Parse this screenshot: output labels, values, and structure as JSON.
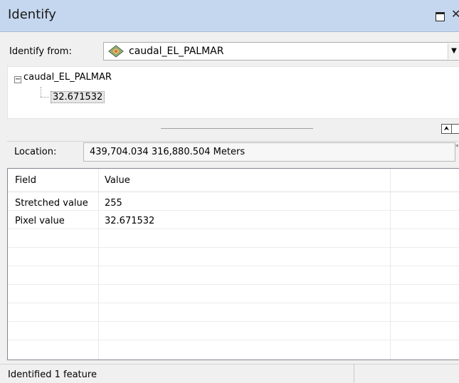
{
  "window": {
    "title": "Identify"
  },
  "titlebar_icons": [
    "restore-icon",
    "close-icon"
  ],
  "identify_from": {
    "label": "Identify from:",
    "selected": "caudal_EL_PALMAR",
    "icon": "raster-layer-icon"
  },
  "tree": {
    "root": "caudal_EL_PALMAR",
    "expander": "⊟",
    "children": [
      "32.671532"
    ]
  },
  "location": {
    "label": "Location:",
    "value": "439,704.034  316,880.504 Meters"
  },
  "table": {
    "columns": [
      "Field",
      "Value"
    ],
    "rows": [
      {
        "field": "Stretched value",
        "value": "255"
      },
      {
        "field": "Pixel value",
        "value": "32.671532"
      }
    ]
  },
  "status": {
    "text": "Identified 1 feature"
  },
  "colors": {
    "titlebar": "#c5d7ee",
    "selection": "#e6e6e6"
  }
}
